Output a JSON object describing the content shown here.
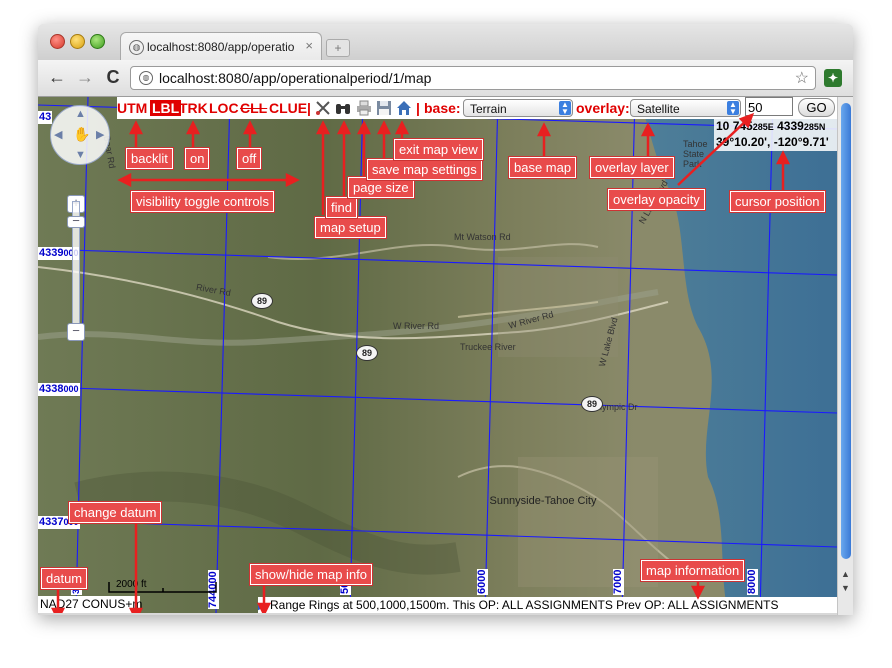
{
  "browser": {
    "tab_title": "localhost:8080/app/operatio",
    "tab_close": "×",
    "new_tab": "+",
    "url": "localhost:8080/app/operationalperiod/1/map",
    "back": "←",
    "forward": "→",
    "reload": "C",
    "star": "☆"
  },
  "toolbar": {
    "toggles": [
      {
        "label": "UTM",
        "state": "on"
      },
      {
        "label": "LBL",
        "state": "backlit"
      },
      {
        "label": "TRK",
        "state": "on"
      },
      {
        "label": "LOC",
        "state": "on"
      },
      {
        "label": "CLL",
        "state": "off"
      },
      {
        "label": "CLUE",
        "state": "on"
      }
    ],
    "separator": "|",
    "base_label": "base:",
    "base_value": "Terrain",
    "overlay_label": "overlay:",
    "overlay_value": "Satellite",
    "opacity_value": "50",
    "go_label": "GO"
  },
  "cursor_position": {
    "utm_zone": "10",
    "easting_major": "745",
    "easting_minor": "285E",
    "northing_major": "4339",
    "northing_minor": "285N",
    "latlon": "39°10.20', -120°9.71'"
  },
  "grid_labels": {
    "rows": [
      {
        "major": "4339",
        "minor": "000"
      },
      {
        "major": "4338",
        "minor": "000"
      },
      {
        "major": "4337",
        "minor": "000"
      }
    ],
    "top_row_major": "43",
    "columns": [
      "744000",
      "5000",
      "6000",
      "7000",
      "8000"
    ],
    "bottom_left_column": "3000"
  },
  "map": {
    "scale_label": "2000 ft",
    "datum": "NAD27 CONUS+m",
    "info": "Range Rings at 500,1000,1500m. This OP: ALL ASSIGNMENTS Prev OP: ALL ASSIGNMENTS",
    "roads": [
      "River Rd",
      "W River Rd",
      "Mt Watson Rd",
      "W Lake Blvd",
      "Truckee River",
      "Olympic Dr",
      "Bear Rd",
      "N Lake Blvd",
      "Tahoe State Park",
      "Sunnyside-Tahoe City"
    ],
    "highway": "89"
  },
  "annotations": {
    "backlit": "backlit",
    "on": "on",
    "off": "off",
    "visibility": "visibility toggle controls",
    "map_setup": "map setup",
    "find": "find",
    "page_size": "page size",
    "save_settings": "save map settings",
    "exit_view": "exit map view",
    "base_map": "base map",
    "overlay_layer": "overlay layer",
    "overlay_opacity": "overlay opacity",
    "cursor_position": "cursor position",
    "change_datum": "change datum",
    "datum": "datum",
    "show_hide": "show/hide map info",
    "map_information": "map information"
  },
  "colors": {
    "toggle_red": "#e00000",
    "grid_blue": "#1a1aff",
    "annotation_bg": "#e84b4b",
    "scroll_thumb": "#3a79d6"
  },
  "icons": [
    "map-setup-icon",
    "binoculars-icon",
    "printer-icon",
    "floppy-disk-icon",
    "home-icon",
    "pan-hand-icon",
    "globe-icon",
    "extension-icon"
  ]
}
